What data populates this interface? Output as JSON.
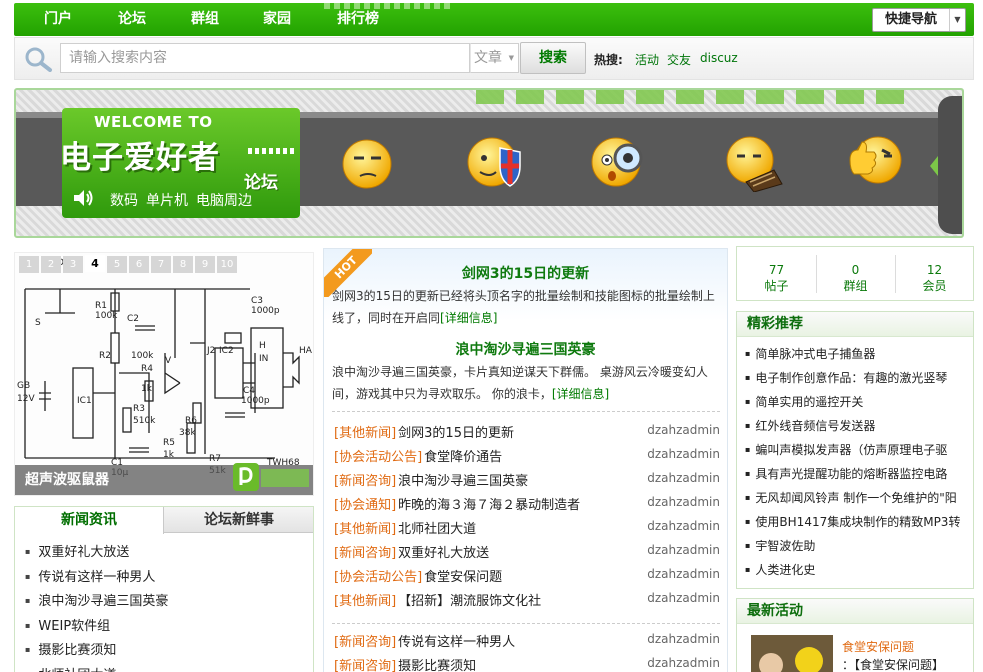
{
  "nav": {
    "items": [
      "门户",
      "论坛",
      "群组",
      "家园",
      "排行榜"
    ],
    "quick_nav": "快捷导航"
  },
  "search": {
    "placeholder": "请输入搜索内容",
    "type": "文章",
    "button": "搜索",
    "hot_label": "热搜:",
    "hot_links": [
      "活动",
      "交友",
      "discuz"
    ]
  },
  "banner": {
    "welcome": "WELCOME TO",
    "site_name": "电子爱好者",
    "forum_word": "论坛",
    "tags": [
      "数码",
      "单片机",
      "电脑周边"
    ]
  },
  "slideshow": {
    "pages": [
      "1",
      "2",
      "3",
      "4",
      "5",
      "6",
      "7",
      "8",
      "9",
      "10"
    ],
    "active_page": "4",
    "caption": "超声波驱鼠器"
  },
  "left_tabs": {
    "tabs": [
      "新闻资讯",
      "论坛新鲜事"
    ],
    "items": [
      "双重好礼大放送",
      "传说有这样一种男人",
      "浪中淘沙寻遍三国英豪",
      "WEIP软件组",
      "摄影比赛须知",
      "北师社团大道"
    ]
  },
  "featured": {
    "badge": "HOT",
    "articles": [
      {
        "title": "剑网3的15日的更新",
        "text": "剑网3的15日的更新已经将头顶名字的批量绘制和技能图标的批量绘制上线了，同时在开启同",
        "more": "[详细信息]"
      },
      {
        "title": "浪中淘沙寻遍三国英豪",
        "text": "浪中淘沙寻遍三国英豪，卡片真知逆谋天下群儒。 桌游风云冷暖变幻人间，游戏其中只为寻欢取乐。 你的浪卡，",
        "more": "[详细信息]"
      }
    ]
  },
  "mid_list_1": [
    {
      "cat": "[其他新闻]",
      "title": "剑网3的15日的更新",
      "author": "dzahzadmin"
    },
    {
      "cat": "[协会活动公告]",
      "title": "食堂降价通告",
      "author": "dzahzadmin"
    },
    {
      "cat": "[新闻咨询]",
      "title": "浪中淘沙寻遍三国英豪",
      "author": "dzahzadmin"
    },
    {
      "cat": "[协会通知]",
      "title": "昨晚的海３海７海２暴动制造者",
      "author": "dzahzadmin"
    },
    {
      "cat": "[其他新闻]",
      "title": "北师社团大道",
      "author": "dzahzadmin"
    },
    {
      "cat": "[新闻咨询]",
      "title": "双重好礼大放送",
      "author": "dzahzadmin"
    },
    {
      "cat": "[协会活动公告]",
      "title": "食堂安保问题",
      "author": "dzahzadmin"
    },
    {
      "cat": "[其他新闻]",
      "title": "【招新】潮流服饰文化社",
      "author": "dzahzadmin"
    }
  ],
  "mid_list_2": [
    {
      "cat": "[新闻咨询]",
      "title": "传说有这样一种男人",
      "author": "dzahzadmin"
    },
    {
      "cat": "[新闻咨询]",
      "title": "摄影比赛须知",
      "author": "dzahzadmin"
    }
  ],
  "stats": [
    {
      "num": "77",
      "label": "帖子"
    },
    {
      "num": "0",
      "label": "群组"
    },
    {
      "num": "12",
      "label": "会员"
    }
  ],
  "recommend": {
    "title": "精彩推荐",
    "items": [
      "简单脉冲式电子捕鱼器",
      "电子制作创意作品：有趣的激光竖琴",
      "简单实用的遥控开关",
      "红外线音频信号发送器",
      "蝙叫声模拟发声器（仿声原理电子驱",
      "具有声光提醒功能的熔断器监控电路",
      "无风却闻风铃声 制作一个免维护的\"阳",
      "使用BH1417集成块制作的精致MP3转",
      "宇智波佐助",
      "人类进化史"
    ]
  },
  "activity": {
    "title": "最新活动",
    "item_title": "食堂安保问题",
    "item_sub": "：【食堂安保问题】"
  },
  "colors": {
    "brand_green": "#22a200",
    "link_green": "#007a00",
    "category_orange": "#e06a12"
  }
}
